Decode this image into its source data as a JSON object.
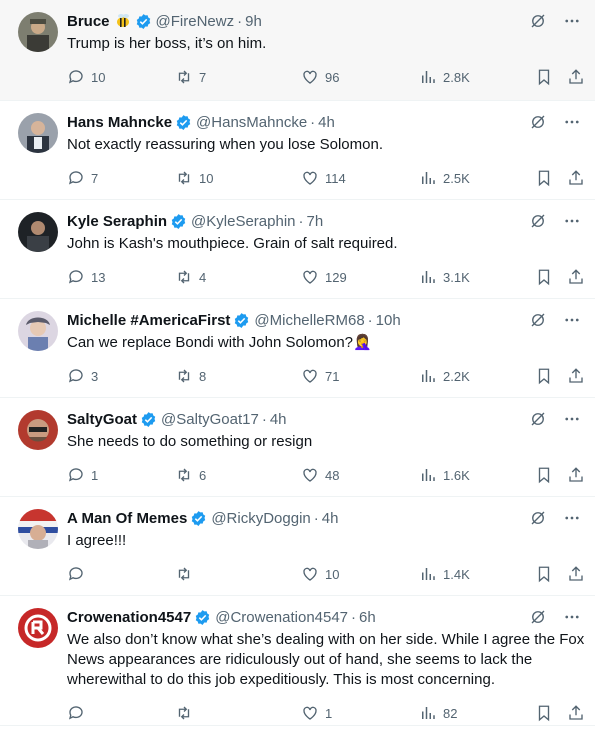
{
  "posts": [
    {
      "name": "Bruce",
      "badge_emoji": "bee-emoji",
      "handle": "@FireNewz",
      "time": "9h",
      "text": "Trump is her boss, it’s on him.",
      "replies": "10",
      "reposts": "7",
      "likes": "96",
      "views": "2.8K"
    },
    {
      "name": "Hans Mahncke",
      "handle": "@HansMahncke",
      "time": "4h",
      "text": "Not exactly reassuring when you lose Solomon.",
      "replies": "7",
      "reposts": "10",
      "likes": "114",
      "views": "2.5K"
    },
    {
      "name": "Kyle Seraphin",
      "handle": "@KyleSeraphin",
      "time": "7h",
      "text": "John is Kash's mouthpiece. Grain of salt required.",
      "replies": "13",
      "reposts": "4",
      "likes": "129",
      "views": "3.1K"
    },
    {
      "name": "Michelle #AmericaFirst",
      "handle": "@MichelleRM68",
      "time": "10h",
      "text": "Can we replace Bondi with John Solomon?🤦‍♀️",
      "replies": "3",
      "reposts": "8",
      "likes": "71",
      "views": "2.2K"
    },
    {
      "name": "SaltyGoat",
      "handle": "@SaltyGoat17",
      "time": "4h",
      "text": "She needs to do something or resign",
      "replies": "1",
      "reposts": "6",
      "likes": "48",
      "views": "1.6K"
    },
    {
      "name": "A Man Of Memes",
      "handle": "@RickyDoggin",
      "time": "4h",
      "text": "I agree!!!",
      "replies": "",
      "reposts": "",
      "likes": "10",
      "views": "1.4K"
    },
    {
      "name": "Crowenation4547",
      "handle": "@Crowenation4547",
      "time": "6h",
      "text": "We also don’t know what she’s dealing with on her side. While I agree the Fox News appearances are ridiculously out of hand, she seems to lack the wherewithal to do this job expeditiously.  This is most concerning.",
      "replies": "",
      "reposts": "",
      "likes": "1",
      "views": "82"
    }
  ],
  "colors": {
    "verified": "#1d9bf0",
    "muted": "#536471",
    "text": "#0f1419"
  }
}
